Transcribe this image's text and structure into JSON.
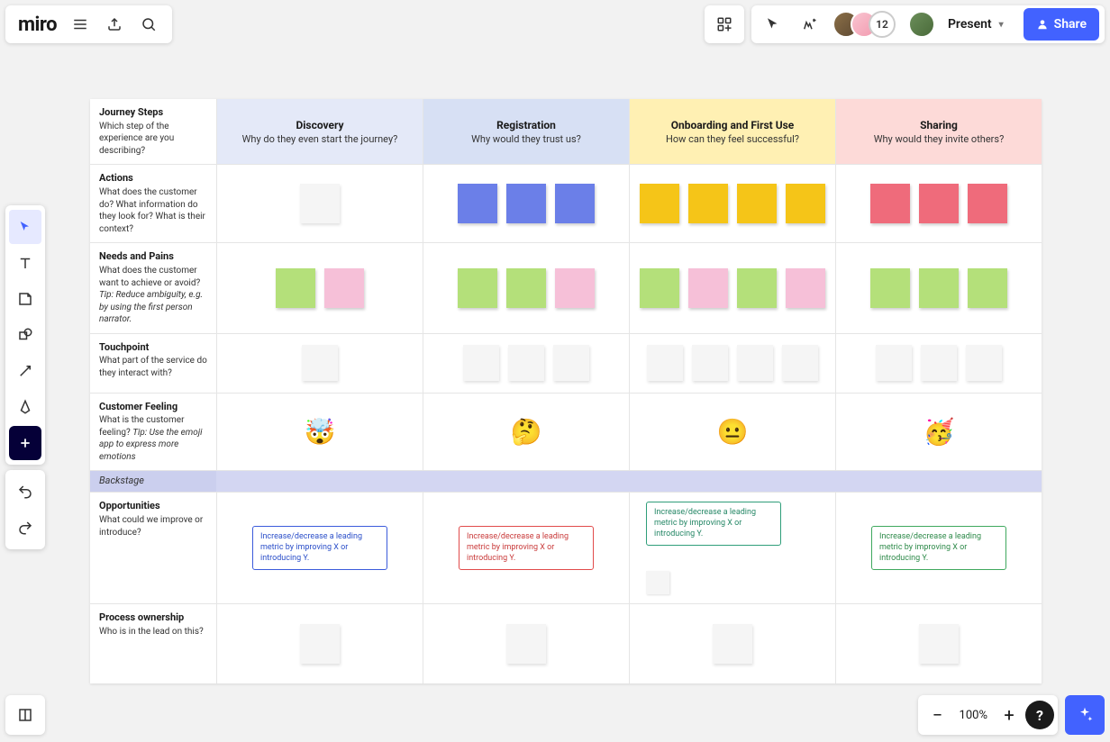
{
  "app": {
    "logo": "miro"
  },
  "topbar": {
    "present_label": "Present",
    "share_label": "Share",
    "overflow_count": "12"
  },
  "toolbar": {
    "zoom": "100%"
  },
  "board": {
    "phases": [
      {
        "key": "discovery",
        "title": "Discovery",
        "subtitle": "Why do they even start the journey?"
      },
      {
        "key": "registration",
        "title": "Registration",
        "subtitle": "Why would they trust us?"
      },
      {
        "key": "onboarding",
        "title": "Onboarding and First Use",
        "subtitle": "How can they feel successful?"
      },
      {
        "key": "sharing",
        "title": "Sharing",
        "subtitle": "Why would they invite others?"
      }
    ],
    "rows": {
      "journey": {
        "title": "Journey Steps",
        "desc": "Which step of the experience are you describing?"
      },
      "actions": {
        "title": "Actions",
        "desc": "What does the customer do? What information do they look for? What is their context?"
      },
      "needs": {
        "title": "Needs and Pains",
        "desc": "What does the customer want to achieve or avoid?",
        "tip": "Tip: Reduce ambiguity, e.g. by using the first person narrator."
      },
      "touch": {
        "title": "Touchpoint",
        "desc": "What part of the service do they interact with?"
      },
      "feeling": {
        "title": "Customer Feeling",
        "desc": "What is the customer feeling?",
        "tip": "Tip: Use the emoji app to express more emotions"
      },
      "backstage": {
        "title": "Backstage"
      },
      "opps": {
        "title": "Opportunities",
        "desc": "What could we improve or introduce?"
      },
      "owner": {
        "title": "Process ownership",
        "desc": "Who is in the lead on this?"
      }
    },
    "feeling_emojis": {
      "discovery": "🤯",
      "registration": "🤔",
      "onboarding": "😐",
      "sharing": "🥳"
    },
    "opportunity_text": "Increase/decrease a leading metric by improving X or introducing Y."
  }
}
